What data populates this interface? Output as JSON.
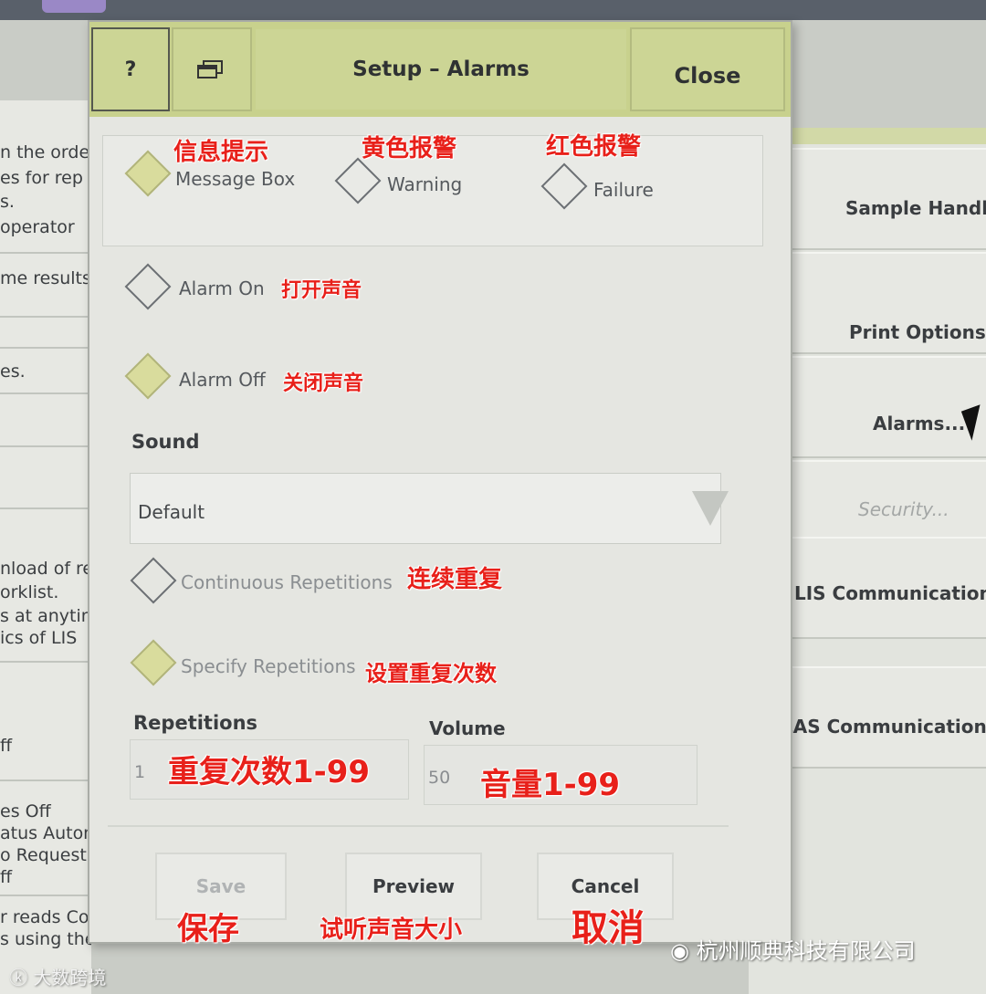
{
  "background_left": {
    "snippets": [
      "n the orde",
      "es for rep",
      "s.",
      "operator",
      "me results",
      "es.",
      "nload of re",
      "orklist.",
      "s at anytim",
      "ics of LIS",
      "ff",
      "es Off",
      "atus Automa",
      "o Request",
      "ff",
      "r reads Cod",
      "s using the"
    ]
  },
  "right_menu": {
    "items": [
      {
        "label": "Sample Handli",
        "enabled": true
      },
      {
        "label": "Print Options..",
        "enabled": true
      },
      {
        "label": "Alarms...",
        "enabled": true
      },
      {
        "label": "Security...",
        "enabled": false
      },
      {
        "label": "LIS Communications",
        "enabled": true
      },
      {
        "label": "LAS Communications.",
        "enabled": true
      }
    ]
  },
  "dialog": {
    "title": "Setup – Alarms",
    "help_label": "?",
    "window_icon": "window-stack-icon",
    "close_label": "Close",
    "alarm_type": {
      "options": [
        {
          "label": "Message Box",
          "annotation": "信息提示",
          "selected": true
        },
        {
          "label": "Warning",
          "annotation": "黄色报警",
          "selected": false
        },
        {
          "label": "Failure",
          "annotation": "红色报警",
          "selected": false
        }
      ]
    },
    "alarm_sound": {
      "on_label": "Alarm On",
      "on_annotation": "打开声音",
      "off_label": "Alarm Off",
      "off_annotation": "关闭声音",
      "selected": "off"
    },
    "sound": {
      "label": "Sound",
      "value": "Default"
    },
    "repetition_mode": {
      "continuous_label": "Continuous Repetitions",
      "continuous_annotation": "连续重复",
      "specify_label": "Specify Repetitions",
      "specify_annotation": "设置重复次数",
      "selected": "specify"
    },
    "repetitions": {
      "label": "Repetitions",
      "value": "1",
      "annotation": "重复次数1-99"
    },
    "volume": {
      "label": "Volume",
      "value": "50",
      "annotation": "音量1-99"
    },
    "buttons": {
      "save": "Save",
      "save_annotation": "保存",
      "preview": "Preview",
      "preview_annotation": "试听声音大小",
      "cancel": "Cancel",
      "cancel_annotation": "取消"
    }
  },
  "watermarks": {
    "company": "杭州顺典科技有限公司",
    "source": "大数跨境"
  },
  "colors": {
    "toolbar": "#c8d18d",
    "selected_radio": "#d9dc9d",
    "annotation": "#e8201a"
  }
}
